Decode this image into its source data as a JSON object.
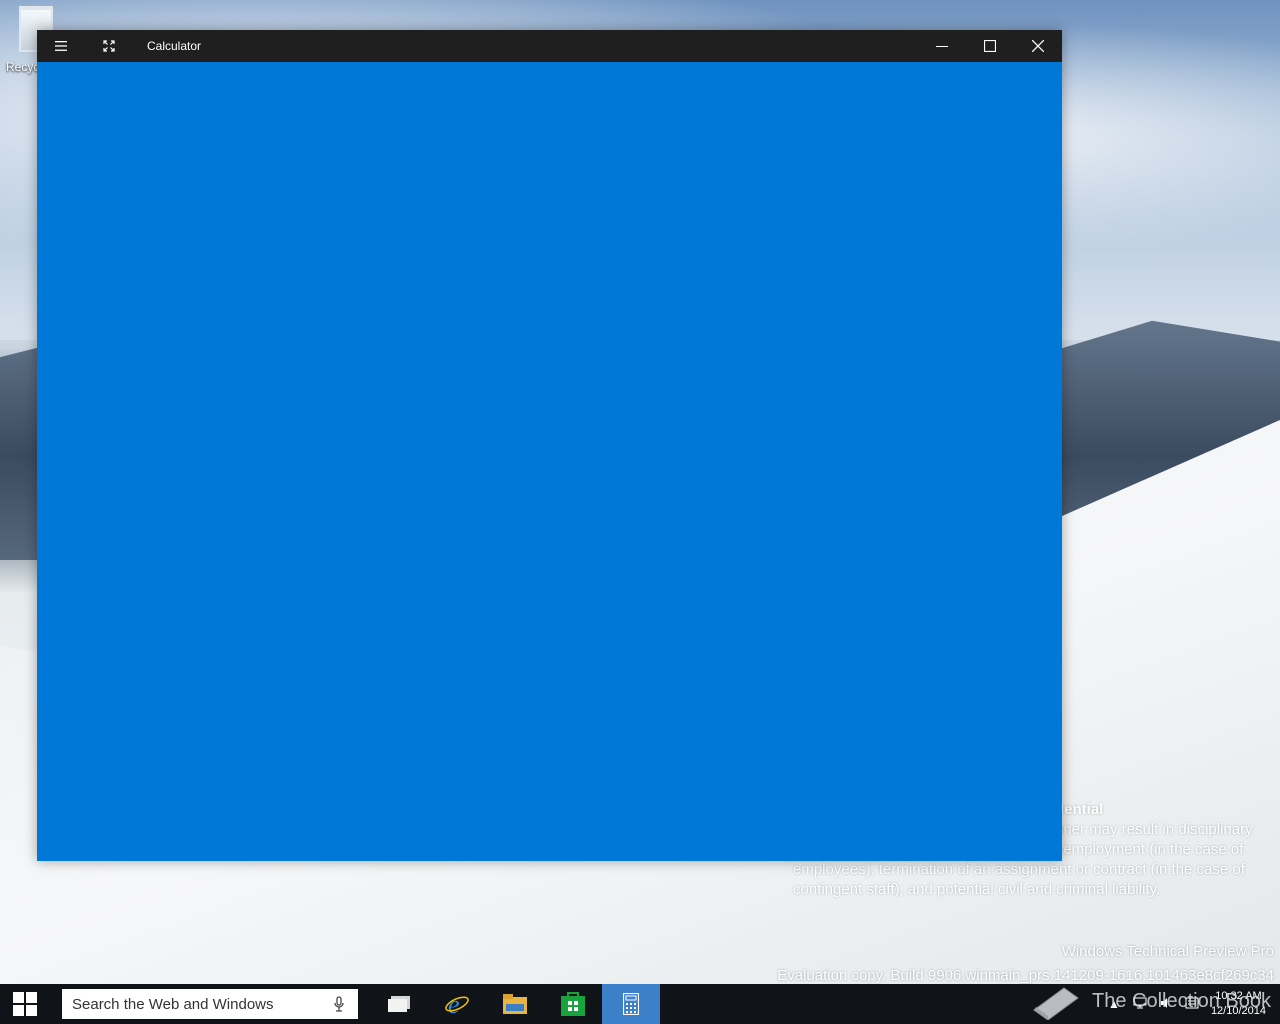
{
  "desktop": {
    "recycle_bin_label": "Recyc",
    "watermark": {
      "title": "dential",
      "lines": [
        "nner may result in disciplinary",
        "f employment (in the case of",
        "employees), termination of an assignment or contract (in the case of",
        "contingent staff), and potential civil and criminal liability."
      ]
    },
    "build_info": {
      "edition": "Windows Technical Preview Pro",
      "build": "Evaluation copy. Build 9906.winmain_prs.141209-1616.101463e8cf269c34"
    },
    "overlay_logo_text": "The Collection Book"
  },
  "window": {
    "title": "Calculator",
    "accent_color": "#0078d7",
    "titlebar_color": "#1f1f1f",
    "icons": {
      "menu": "hamburger-icon",
      "fullscreen": "fullscreen-icon",
      "minimize": "minimize-icon",
      "maximize": "maximize-icon",
      "close": "close-icon"
    }
  },
  "taskbar": {
    "search_placeholder": "Search the Web and Windows",
    "apps": [
      "task-view",
      "internet-explorer",
      "file-explorer",
      "store",
      "calculator"
    ],
    "active_app": "calculator",
    "clock": {
      "time": "10:32 AM",
      "date": "12/10/2014"
    }
  }
}
